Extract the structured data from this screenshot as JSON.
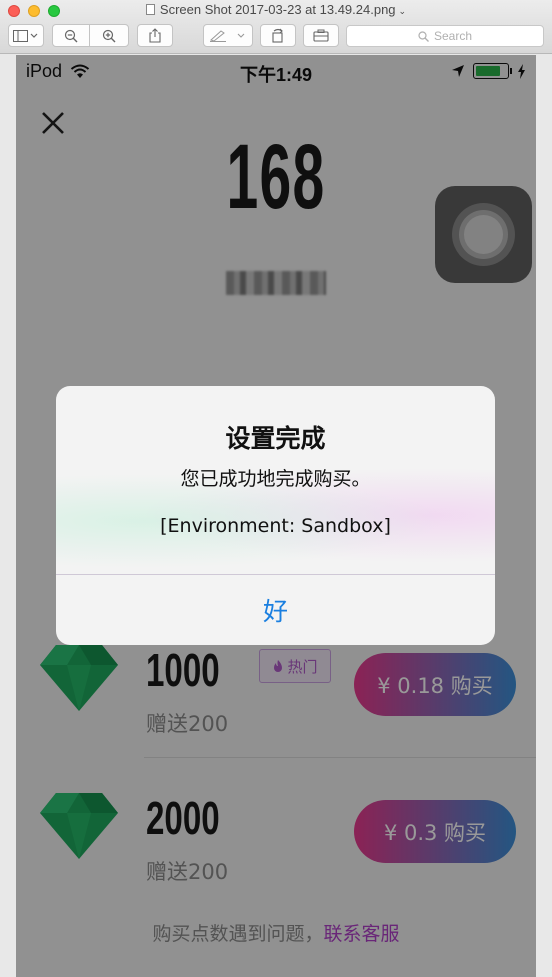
{
  "window": {
    "title": "Screen Shot 2017-03-23 at 13.49.24.png",
    "search_placeholder": "Search"
  },
  "status_bar": {
    "carrier": "iPod",
    "time": "下午1:49"
  },
  "balance": "168",
  "packages": [
    {
      "amount": "1000",
      "bonus": "赠送200",
      "hot_label": "热门",
      "price_label": "¥ 0.18 购买"
    },
    {
      "amount": "2000",
      "bonus": "赠送200",
      "price_label": "¥ 0.3 购买"
    }
  ],
  "footer": {
    "text": "购买点数遇到问题，",
    "link": "联系客服"
  },
  "alert": {
    "title": "设置完成",
    "message": "您已成功地完成购买。",
    "environment": "[Environment: Sandbox]",
    "ok": "好"
  },
  "colors": {
    "accent_link": "#1a7fe0",
    "buy_gradient_start": "#e83a8e",
    "buy_gradient_end": "#3c8fd8",
    "diamond": "#1fa85e",
    "hot_tag": "#b05cc8"
  }
}
